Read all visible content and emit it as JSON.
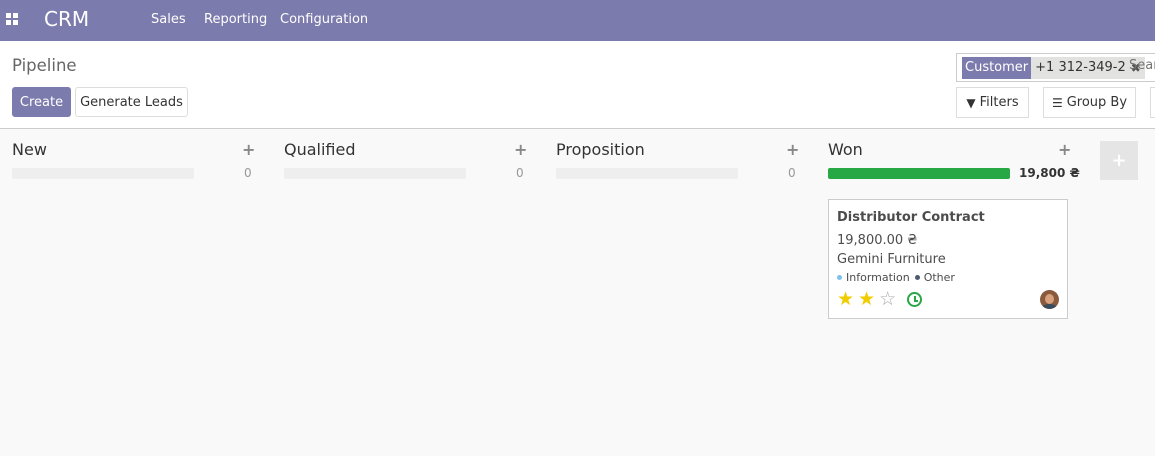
{
  "navbar": {
    "app_title": "CRM",
    "menu": [
      "Sales",
      "Reporting",
      "Configuration"
    ]
  },
  "control_panel": {
    "breadcrumb": "Pipeline",
    "create_label": "Create",
    "generate_label": "Generate Leads",
    "search": {
      "facet_category": "Customer",
      "facet_value": "+1 312-349-2",
      "placeholder": "Search..."
    },
    "filters_label": "Filters",
    "groupby_label": "Group By"
  },
  "kanban": {
    "columns": [
      {
        "title": "New",
        "count": "0"
      },
      {
        "title": "Qualified",
        "count": "0"
      },
      {
        "title": "Proposition",
        "count": "0"
      },
      {
        "title": "Won",
        "count": "19,800 ₴"
      }
    ],
    "card": {
      "title": "Distributor Contract",
      "amount": "19,800.00 ₴",
      "partner": "Gemini Furniture",
      "tags": [
        {
          "label": "Information",
          "color": "#7ec0ee"
        },
        {
          "label": "Other",
          "color": "#4c5a6e"
        }
      ],
      "priority_stars": 2,
      "priority_max": 3
    }
  },
  "colors": {
    "brand": "#7c7bad",
    "won_bar": "#28a745",
    "star": "#f3cc00"
  }
}
